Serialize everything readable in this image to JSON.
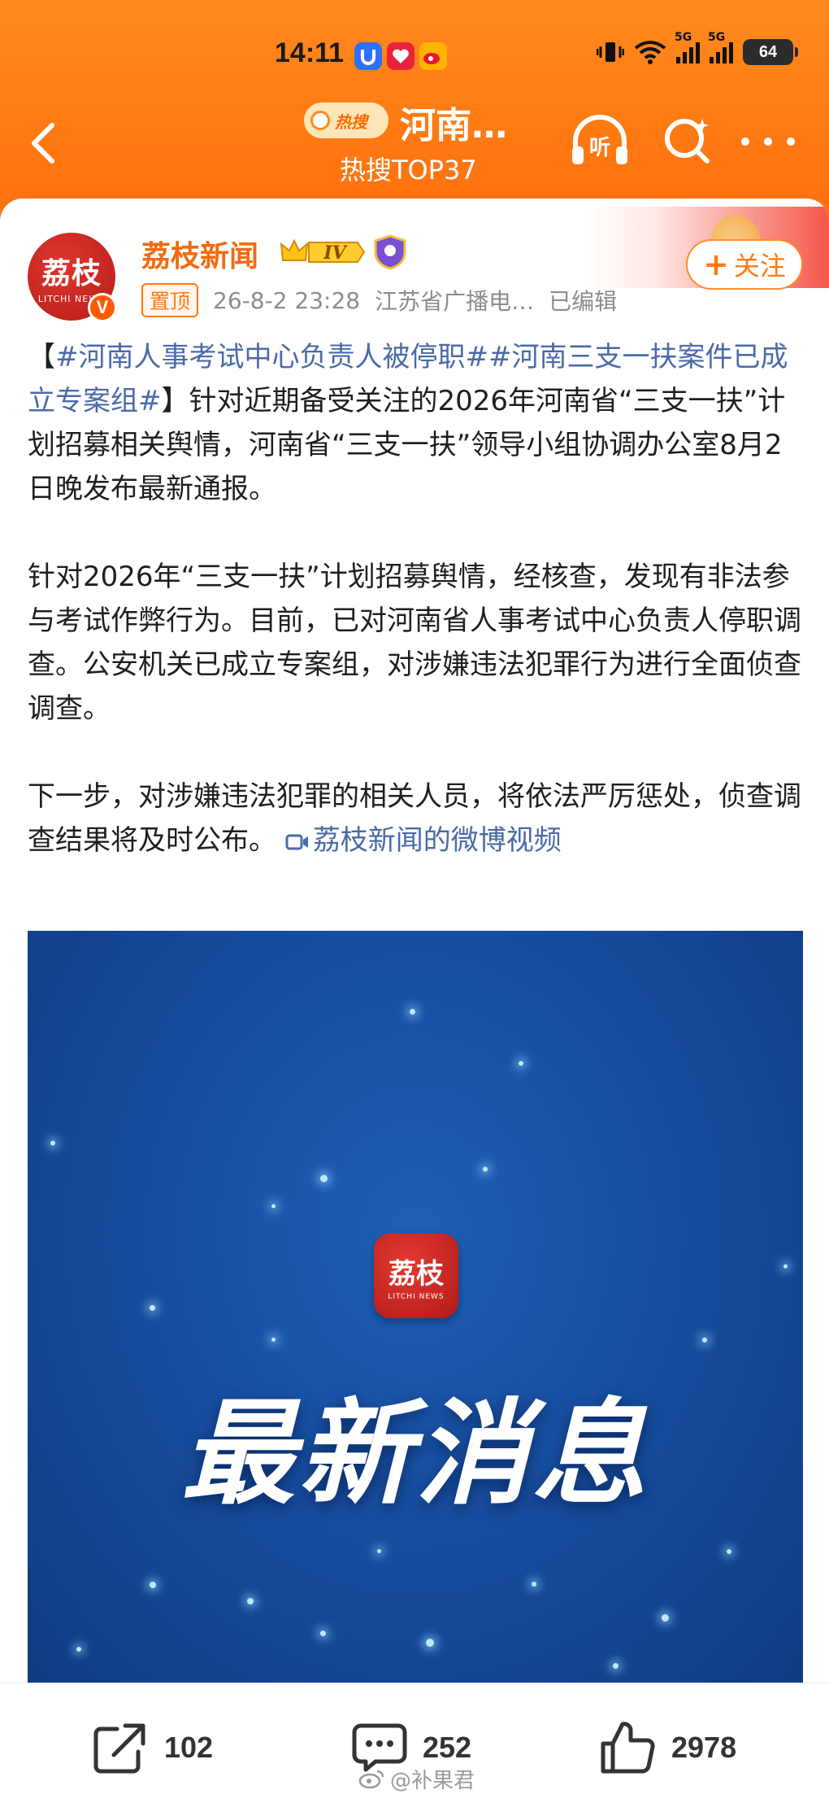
{
  "status_bar": {
    "time": "14:11",
    "battery": "64",
    "signal_1": "5G",
    "signal_2": "5G"
  },
  "nav": {
    "hot_label": "热搜",
    "title": "河南…",
    "subtitle": "热搜TOP37",
    "listen_label": "听"
  },
  "post": {
    "author": "荔枝新闻",
    "level": "IV",
    "pin_label": "置顶",
    "timestamp": "26-8-2 23:28",
    "source": "江苏省广播电…",
    "edited": "已编辑",
    "follow_label": "关注",
    "avatar_text": "荔枝",
    "avatar_sub": "LITCHI NEWS",
    "avatar_badge": "V",
    "tag1": "#河南人事考试中心负责人被停职#",
    "tag2": "#河南三支一扶案件已成立专案组#",
    "para1_rest": "】针对近期备受关注的2026年河南省“三支一扶”计划招募相关舆情，河南省“三支一扶”领导小组协调办公室8月2日晚发布最新通报。",
    "para2": "针对2026年“三支一扶”计划招募舆情，经核查，发现有非法参与考试作弊行为。目前，已对河南省人事考试中心负责人停职调查。公安机关已成立专案组，对涉嫌违法犯罪行为进行全面侦查调查。",
    "para3": "下一步，对涉嫌违法犯罪的相关人员，将依法严厉惩处，侦查调查结果将及时公布。",
    "video_link": "荔枝新闻的微博视频"
  },
  "video": {
    "logo_text": "荔枝",
    "logo_sub": "LITCHI NEWS",
    "headline": "最新消息"
  },
  "actions": {
    "share_count": "102",
    "comment_count": "252",
    "like_count": "2978"
  },
  "watermark": "@补果君",
  "colors": {
    "header_orange": "#ff7a12",
    "author_orange": "#f26b0f",
    "link_blue": "#4a6aa8",
    "video_blue": "#1850a2"
  }
}
